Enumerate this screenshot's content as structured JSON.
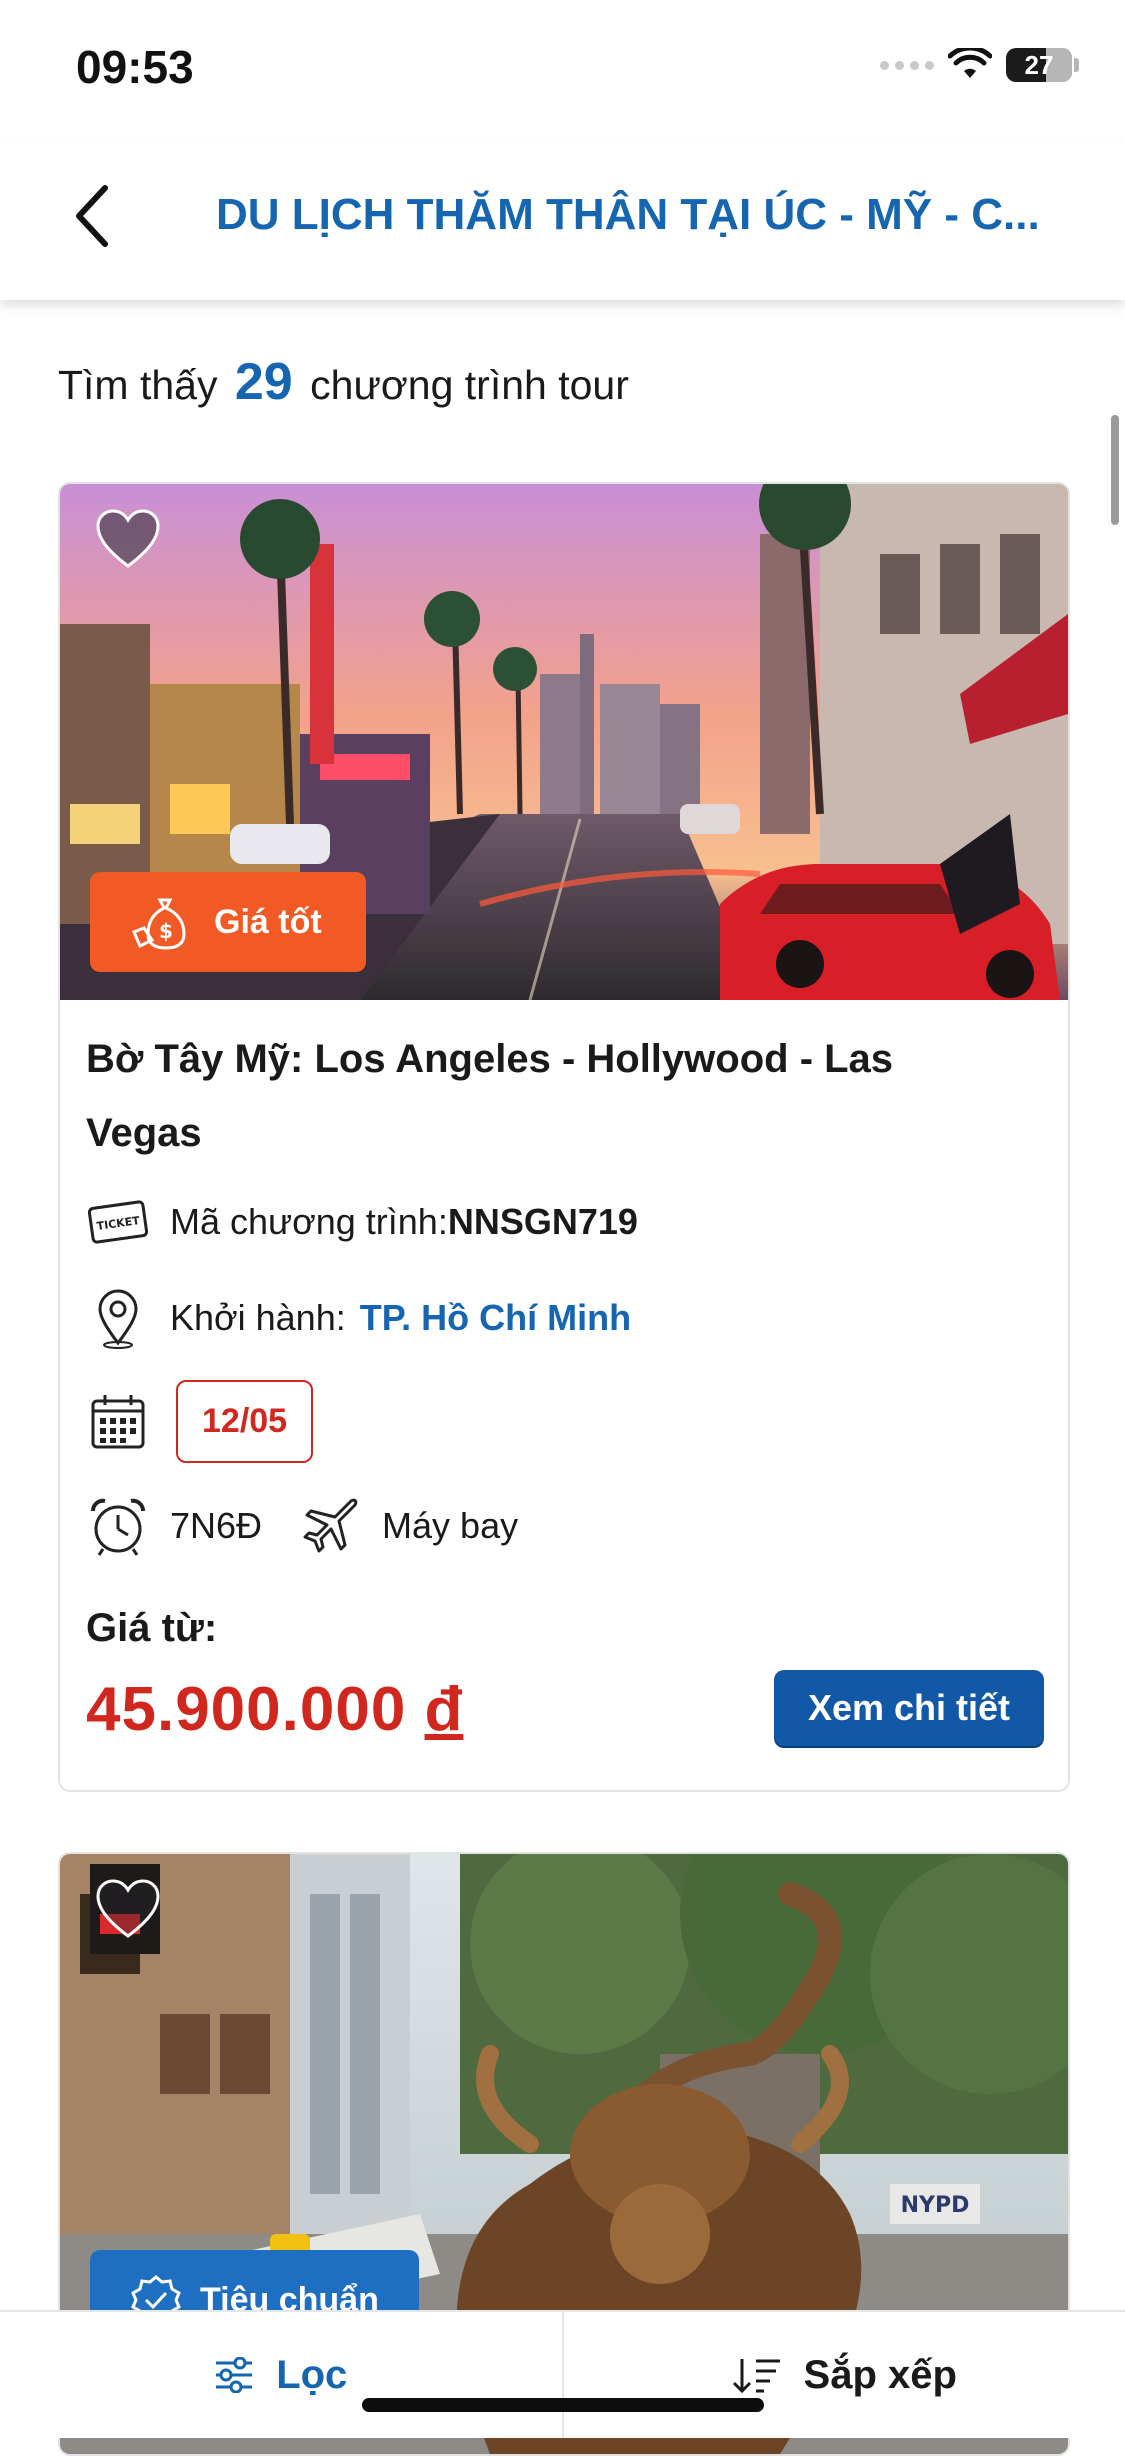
{
  "status_bar": {
    "time": "09:53",
    "battery": "27"
  },
  "header": {
    "title": "DU LỊCH THĂM THÂN TẠI ÚC - MỸ - C..."
  },
  "results": {
    "prefix": "Tìm thấy",
    "count": "29",
    "suffix": "chương trình tour"
  },
  "tours": [
    {
      "badge": "Giá tốt",
      "title": "Bờ Tây Mỹ: Los Angeles - Hollywood - Las Vegas",
      "code_label": "Mã chương trình:",
      "code": "NNSGN719",
      "depart_label": "Khởi hành:",
      "depart_city": "TP. Hồ Chí Minh",
      "date": "12/05",
      "duration": "7N6Đ",
      "transport": "Máy bay",
      "price_label": "Giá từ:",
      "price": "45.900.000",
      "currency": "đ",
      "detail_button": "Xem chi tiết"
    },
    {
      "badge": "Tiêu chuẩn"
    }
  ],
  "bottom_bar": {
    "filter_label": "Lọc",
    "sort_label": "Sắp xếp"
  },
  "colors": {
    "primary": "#1565b0",
    "price_red": "#d0281e",
    "badge_orange": "#f15a24",
    "button_blue": "#1158a6"
  }
}
